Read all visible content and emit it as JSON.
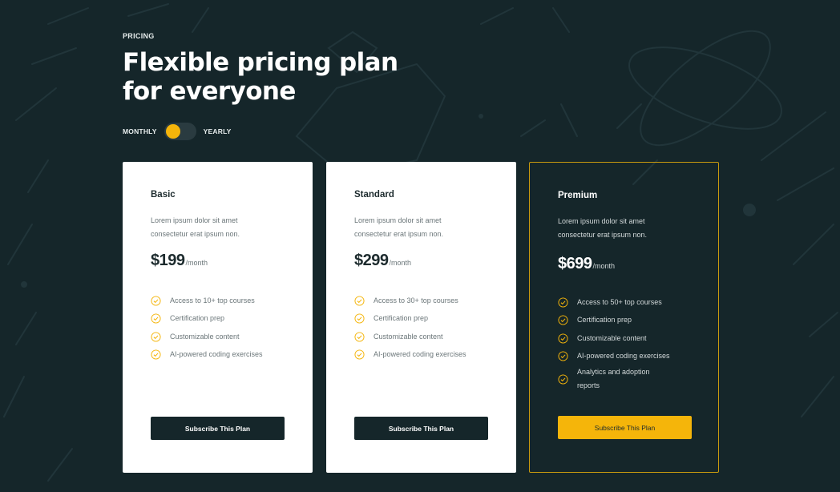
{
  "header": {
    "eyebrow": "PRICING",
    "title_line1": "Flexible pricing plan",
    "title_line2": "for everyone"
  },
  "billing_toggle": {
    "left_label": "MONTHLY",
    "right_label": "YEARLY",
    "selected": "MONTHLY"
  },
  "colors": {
    "background": "#15262a",
    "accent": "#f5b50a",
    "card": "#ffffff"
  },
  "plans": [
    {
      "name": "Basic",
      "desc_line1": "Lorem ipsum dolor sit amet",
      "desc_line2": "consectetur erat ipsum non.",
      "price": "$199",
      "period": "/month",
      "features": [
        "Access to 10+ top courses",
        "Certification prep",
        "Customizable content",
        "AI-powered coding exercises"
      ],
      "button": "Subscribe This Plan"
    },
    {
      "name": "Standard",
      "desc_line1": "Lorem ipsum dolor sit amet",
      "desc_line2": "consectetur erat ipsum non.",
      "price": "$299",
      "period": "/month",
      "features": [
        "Access to 30+ top courses",
        "Certification prep",
        "Customizable content",
        "AI-powered coding exercises"
      ],
      "button": "Subscribe This Plan"
    },
    {
      "name": "Premium",
      "desc_line1": "Lorem ipsum dolor sit amet",
      "desc_line2": "consectetur erat ipsum non.",
      "price": "$699",
      "period": "/month",
      "features": [
        "Access to 50+ top courses",
        "Certification prep",
        "Customizable content",
        "AI-powered coding exercises",
        "Analytics and adoption reports"
      ],
      "button": "Subscribe This Plan"
    }
  ],
  "icons": {
    "feature": "check-circle-icon"
  }
}
